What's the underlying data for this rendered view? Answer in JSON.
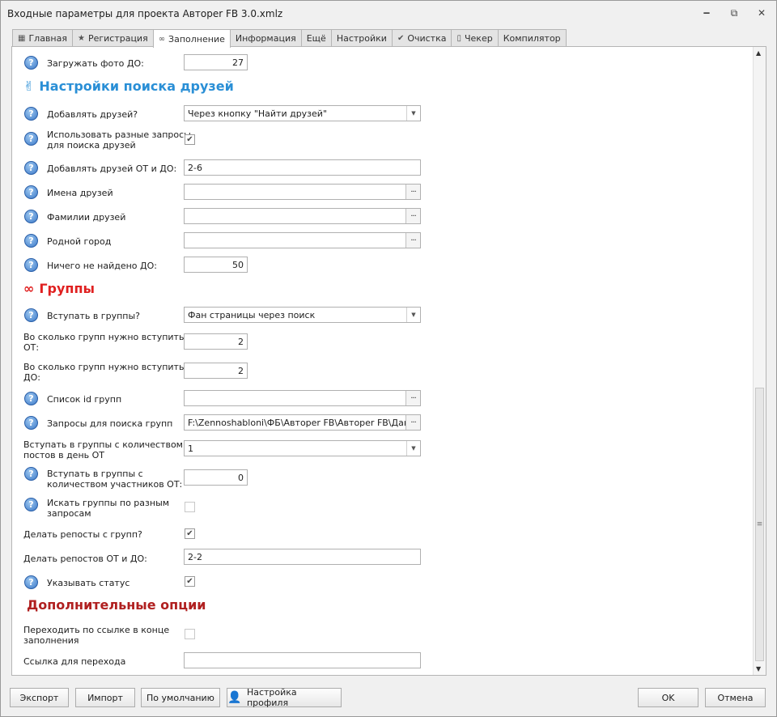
{
  "window": {
    "title": "Входные параметры для проекта Автореr FB 3.0.xmlz",
    "minimize": "🗕",
    "restore": "⧉",
    "close": "✕"
  },
  "tabs": [
    {
      "label": "Главная",
      "icon": "▦"
    },
    {
      "label": "Регистрация",
      "icon": "★"
    },
    {
      "label": "Заполнение",
      "icon": "∞",
      "active": true
    },
    {
      "label": "Информация",
      "icon": ""
    },
    {
      "label": "Ещё",
      "icon": ""
    },
    {
      "label": "Настройки",
      "icon": ""
    },
    {
      "label": "Очистка",
      "icon": "✔"
    },
    {
      "label": "Чекер",
      "icon": "▯"
    },
    {
      "label": "Компилятор",
      "icon": ""
    }
  ],
  "form": {
    "photo_to": {
      "label": "Загружать фото ДО:",
      "value": "27"
    },
    "friends_section": {
      "title": "Настройки поиска друзей",
      "icon": "✌",
      "color": "#2a8fd6"
    },
    "add_friends": {
      "label": "Добавлять друзей?",
      "value": "Через кнопку \"Найти друзей\""
    },
    "diff_queries": {
      "label1": "Использовать разные запросы",
      "label2": "для поиска друзей",
      "checked": true
    },
    "friends_range": {
      "label": "Добавлять друзей ОТ и ДО:",
      "value": "2-6"
    },
    "friend_names": {
      "label": "Имена друзей",
      "value": ""
    },
    "friend_surnames": {
      "label": "Фамилии друзей",
      "value": ""
    },
    "home_city": {
      "label": "Родной город",
      "value": ""
    },
    "nothing_found": {
      "label": "Ничего не найдено ДО:",
      "value": "50"
    },
    "groups_section": {
      "title": "Группы",
      "icon": "∞",
      "color": "#e02020"
    },
    "join_groups": {
      "label": "Вступать в группы?",
      "value": "Фан страницы через поиск"
    },
    "groups_from": {
      "label1": "Во сколько групп нужно вступить",
      "label2": "ОТ:",
      "value": "2"
    },
    "groups_to": {
      "label1": "Во сколько групп нужно вступить",
      "label2": "ДО:",
      "value": "2"
    },
    "group_ids": {
      "label": "Список id групп",
      "value": ""
    },
    "group_queries": {
      "label": "Запросы для поиска групп",
      "value": "F:\\Zennoshabloni\\ФБ\\Автореr FB\\Автореr FB\\Данные"
    },
    "posts_per_day": {
      "label1": "Вступать в группы с количеством",
      "label2": "постов в день ОТ",
      "value": "1"
    },
    "members_from": {
      "label1": "Вступать в группы с",
      "label2": "количеством участников ОТ:",
      "value": "0"
    },
    "search_diff": {
      "label1": "Искать группы по разным",
      "label2": "запросам",
      "checked": false
    },
    "reposts": {
      "label": "Делать репосты с групп?",
      "checked": true
    },
    "reposts_range": {
      "label": "Делать репостов ОТ и ДО:",
      "value": "2-2"
    },
    "set_status": {
      "label": "Указывать статус",
      "checked": true
    },
    "extra_section": {
      "title": "Дополнительные опции",
      "color": "#b02020"
    },
    "follow_link": {
      "label1": "Переходить по ссылке в конце",
      "label2": "заполнения",
      "checked": false
    },
    "link": {
      "label": "Ссылка для перехода",
      "value": ""
    }
  },
  "buttons": {
    "export": "Экспорт",
    "import": "Импорт",
    "default": "По умолчанию",
    "profile": "Настройка профиля",
    "ok": "OK",
    "cancel": "Отмена"
  },
  "icons": {
    "help": "?",
    "check": "✔",
    "dots": "···",
    "dropdown": "▼",
    "scroll_up": "▲",
    "scroll_down": "▼",
    "grip": "≡",
    "user": "👤"
  }
}
